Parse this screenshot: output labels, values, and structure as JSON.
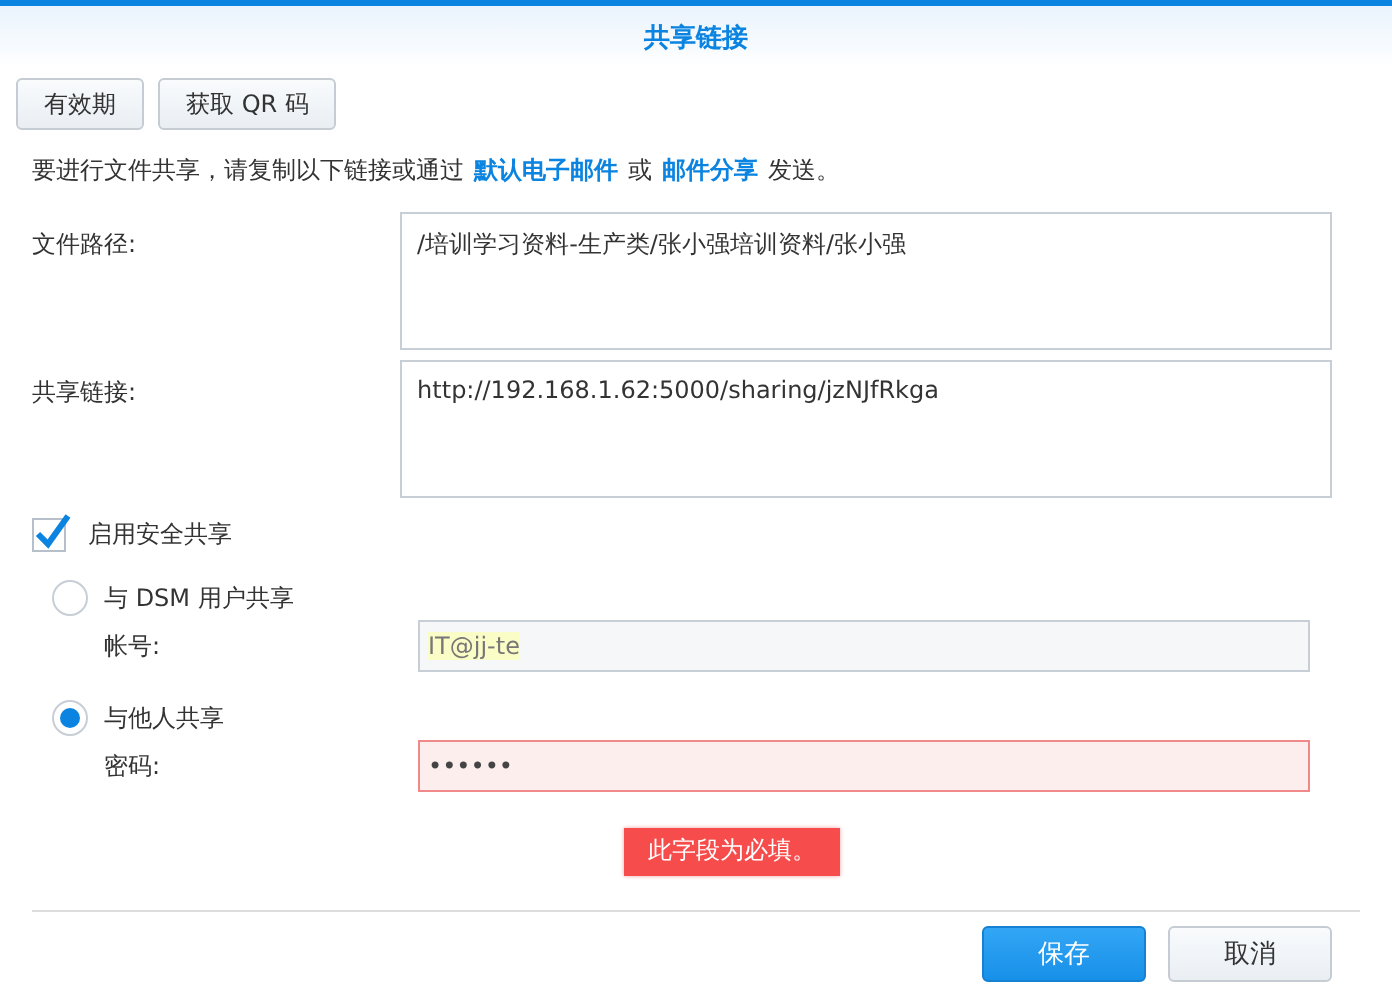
{
  "window": {
    "title": "共享链接"
  },
  "toolbar": [
    {
      "label": "有效期"
    },
    {
      "label": "获取 QR 码"
    }
  ],
  "instruction": [
    {
      "kind": "text",
      "text": "要进行文件共享，请复制以下链接或通过"
    },
    {
      "kind": "link",
      "text": "默认电子邮件"
    },
    {
      "kind": "text",
      "text": "或"
    },
    {
      "kind": "link",
      "text": "邮件分享"
    },
    {
      "kind": "text",
      "text": "发送。"
    }
  ],
  "fields": [
    {
      "label": "文件路径:",
      "value": "/培训学习资料-生产类/张小强培训资料/张小强"
    },
    {
      "label": "共享链接:",
      "value": "http://192.168.1.62:5000/sharing/jzNJfRkga"
    }
  ],
  "secure_share": {
    "label": "启用安全共享",
    "checked": true
  },
  "options": [
    {
      "label": "与 DSM 用户共享",
      "selected": false,
      "field": {
        "label": "帐号:",
        "value": "IT@jj-te",
        "autofilled": true,
        "invalid": false,
        "disabled": true
      }
    },
    {
      "label": "与他人共享",
      "selected": true,
      "field": {
        "label": "密码:",
        "value": "••••••",
        "autofilled": false,
        "invalid": true,
        "disabled": false
      }
    }
  ],
  "error": "此字段为必填。",
  "buttons": [
    {
      "label": "保存",
      "kind": "primary"
    },
    {
      "label": "取消",
      "kind": "default"
    }
  ]
}
